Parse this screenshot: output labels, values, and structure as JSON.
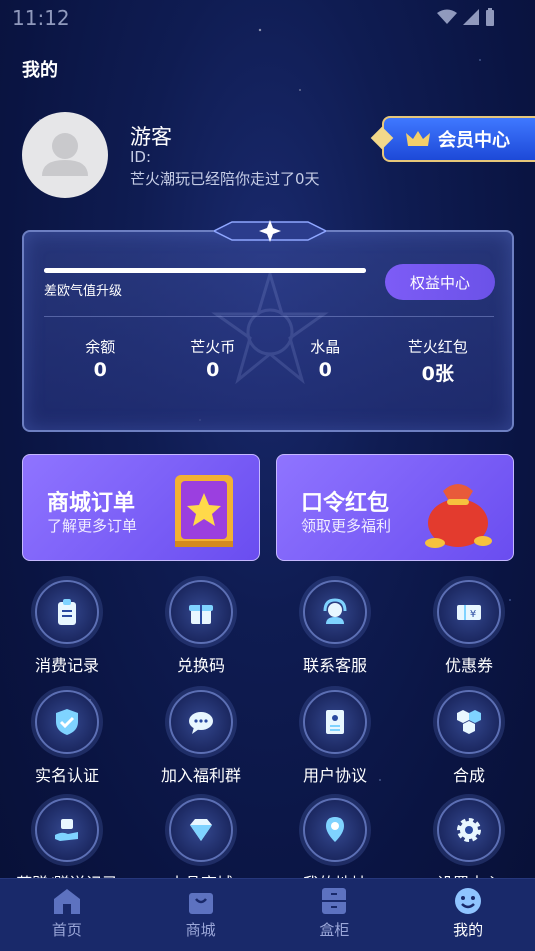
{
  "status_bar": {
    "time": "11:12"
  },
  "page_title": "我的",
  "user": {
    "name": "游客",
    "id_label": "ID:",
    "days_text": "芒火潮玩已经陪你走过了0天"
  },
  "vip_button": {
    "label": "会员中心"
  },
  "card": {
    "progress_label": "差欧气值升级",
    "progress_fraction": 1.0,
    "rights_button": "权益中心",
    "stats": [
      {
        "label": "余额",
        "value": "0"
      },
      {
        "label": "芒火币",
        "value": "0"
      },
      {
        "label": "水晶",
        "value": "0"
      },
      {
        "label": "芒火红包",
        "value": "0张"
      }
    ]
  },
  "promos": [
    {
      "title": "商城订单",
      "subtitle": "了解更多订单",
      "icon": "book-icon"
    },
    {
      "title": "口令红包",
      "subtitle": "领取更多福利",
      "icon": "lucky-bag-icon"
    }
  ],
  "grid": [
    {
      "label": "消费记录",
      "icon": "clipboard-icon"
    },
    {
      "label": "兑换码",
      "icon": "gift-icon"
    },
    {
      "label": "联系客服",
      "icon": "headset-icon"
    },
    {
      "label": "优惠券",
      "icon": "ticket-icon"
    },
    {
      "label": "实名认证",
      "icon": "shield-check-icon"
    },
    {
      "label": "加入福利群",
      "icon": "chat-icon"
    },
    {
      "label": "用户协议",
      "icon": "document-icon"
    },
    {
      "label": "合成",
      "icon": "cubes-icon"
    },
    {
      "label": "获赠/赠送记录",
      "icon": "hand-gift-icon"
    },
    {
      "label": "水晶商城",
      "icon": "diamond-icon"
    },
    {
      "label": "我的地址",
      "icon": "location-icon"
    },
    {
      "label": "设置中心",
      "icon": "gear-icon"
    }
  ],
  "tabs": [
    {
      "label": "首页",
      "icon": "home-icon",
      "active": false
    },
    {
      "label": "商城",
      "icon": "bag-icon",
      "active": false
    },
    {
      "label": "盒柜",
      "icon": "cabinet-icon",
      "active": false
    },
    {
      "label": "我的",
      "icon": "smile-icon",
      "active": true
    }
  ],
  "colors": {
    "accent": "#6b52e8",
    "vip": "#2f62f0",
    "gold": "#e7c77a",
    "background": "#0f1c52"
  }
}
